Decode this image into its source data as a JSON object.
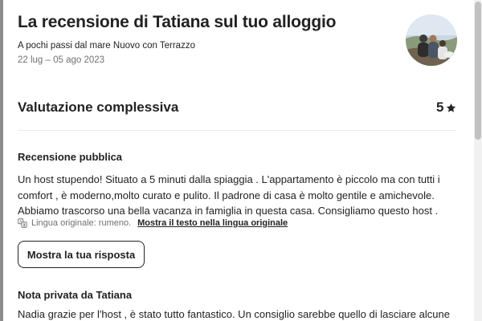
{
  "header": {
    "title": "La recensione di Tatiana sul tuo alloggio",
    "listing_name": "A pochi passi dal mare Nuovo con Terrazzo",
    "dates": "22 lug – 05 ago 2023"
  },
  "rating": {
    "label": "Valutazione complessiva",
    "score": "5",
    "icon": "star-icon"
  },
  "public_review": {
    "heading": "Recensione pubblica",
    "lines": [
      "Un host stupendo! Situato a 5 minuti dalla spiaggia . L'appartamento è piccolo ma con tutti i",
      "comfort , è moderno,molto curato e pulito. Il padrone di casa è molto gentile e amichevole.",
      "Abbiamo trascorso una bella vacanza in famiglia in questa casa. Consigliamo questo host ."
    ],
    "original_language": "Lingua originale: rumeno.",
    "show_original_link": "Mostra il testo nella lingua originale",
    "translate_icon": "translate-icon"
  },
  "response_button": "Mostra la tua risposta",
  "private_note": {
    "heading": "Nota privata da Tatiana",
    "text": "Nadia grazie per l'host , è stato tutto fantastico. Un consiglio sarebbe quello di lasciare alcune"
  },
  "colors": {
    "text": "#222222",
    "muted": "#717171",
    "divider": "#ebebeb"
  }
}
